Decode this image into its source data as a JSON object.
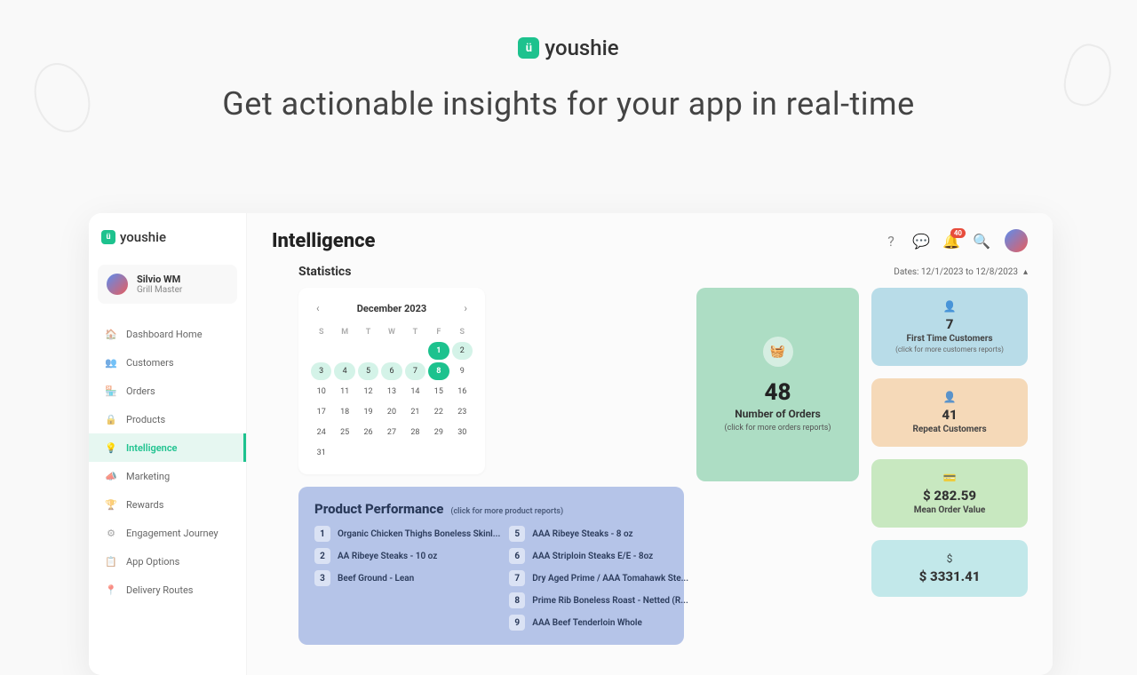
{
  "brand": {
    "name": "youshie",
    "badge": "ü"
  },
  "hero": {
    "tagline": "Get actionable insights for your app in real-time"
  },
  "user": {
    "name": "Silvio WM",
    "role": "Grill Master"
  },
  "nav": {
    "items": [
      {
        "label": "Dashboard Home",
        "icon": "🏠"
      },
      {
        "label": "Customers",
        "icon": "👥"
      },
      {
        "label": "Orders",
        "icon": "🏪"
      },
      {
        "label": "Products",
        "icon": "🔒"
      },
      {
        "label": "Intelligence",
        "icon": "💡"
      },
      {
        "label": "Marketing",
        "icon": "📣"
      },
      {
        "label": "Rewards",
        "icon": "🏆"
      },
      {
        "label": "Engagement Journey",
        "icon": "⚙"
      },
      {
        "label": "App Options",
        "icon": "📋"
      },
      {
        "label": "Delivery Routes",
        "icon": "📍"
      }
    ]
  },
  "page": {
    "title": "Intelligence"
  },
  "header": {
    "notif_count": "40"
  },
  "stats": {
    "title": "Statistics",
    "date_label": "Dates: 12/1/2023 to 12/8/2023"
  },
  "calendar": {
    "month": "December 2023",
    "dow": [
      "S",
      "M",
      "T",
      "W",
      "T",
      "F",
      "S"
    ],
    "days": [
      "",
      "",
      "",
      "",
      "",
      "1",
      "2",
      "3",
      "4",
      "5",
      "6",
      "7",
      "8",
      "9",
      "10",
      "11",
      "12",
      "13",
      "14",
      "15",
      "16",
      "17",
      "18",
      "19",
      "20",
      "21",
      "22",
      "23",
      "24",
      "25",
      "26",
      "27",
      "28",
      "29",
      "30",
      "31"
    ]
  },
  "orders_card": {
    "value": "48",
    "label": "Number of Orders",
    "hint": "(click for more orders reports)"
  },
  "first_time": {
    "value": "7",
    "label": "First Time Customers",
    "hint": "(click for more customers reports)"
  },
  "repeat": {
    "value": "41",
    "label": "Repeat Customers"
  },
  "mean_order": {
    "value": "$ 282.59",
    "label": "Mean Order Value"
  },
  "total": {
    "value": "$ 3331.41"
  },
  "perf": {
    "title": "Product Performance",
    "hint": "(click for more product reports)",
    "left": [
      {
        "rank": "1",
        "name": "Organic Chicken Thighs Boneless Skinl..."
      },
      {
        "rank": "2",
        "name": "AA Ribeye Steaks - 10 oz"
      },
      {
        "rank": "3",
        "name": "Beef Ground - Lean"
      }
    ],
    "right": [
      {
        "rank": "5",
        "name": "AAA Ribeye Steaks - 8 oz"
      },
      {
        "rank": "6",
        "name": "AAA Striploin Steaks E/E - 8oz"
      },
      {
        "rank": "7",
        "name": "Dry Aged Prime / AAA Tomahawk Ste..."
      },
      {
        "rank": "8",
        "name": "Prime Rib Boneless Roast - Netted (R..."
      },
      {
        "rank": "9",
        "name": "AAA Beef Tenderloin Whole"
      }
    ]
  }
}
